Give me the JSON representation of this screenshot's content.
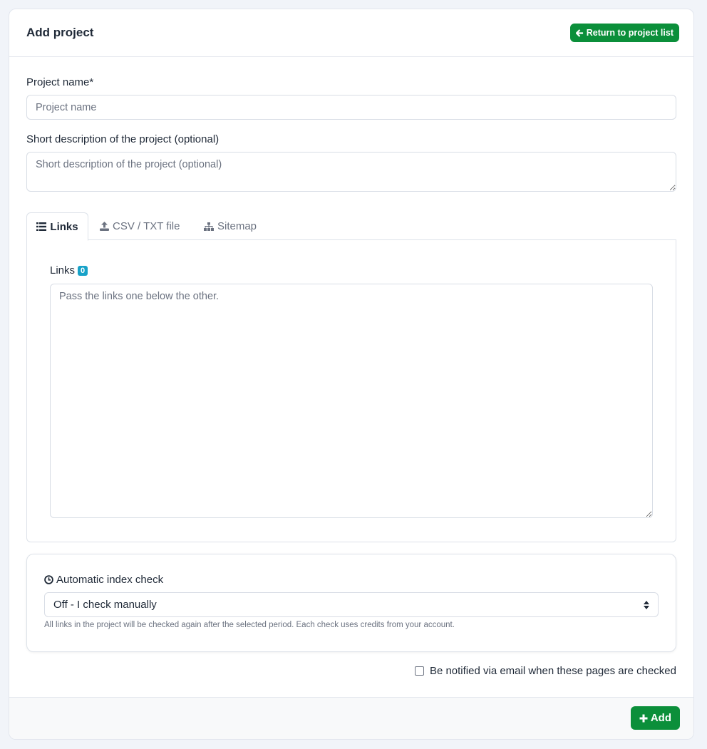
{
  "header": {
    "title": "Add project",
    "return_button": "Return to project list"
  },
  "form": {
    "project_name_label": "Project name*",
    "project_name_placeholder": "Project name",
    "description_label": "Short description of the project (optional)",
    "description_placeholder": "Short description of the project (optional)"
  },
  "tabs": [
    {
      "label": "Links",
      "icon": "list-icon",
      "active": true
    },
    {
      "label": "CSV / TXT file",
      "icon": "upload-icon",
      "active": false
    },
    {
      "label": "Sitemap",
      "icon": "sitemap-icon",
      "active": false
    }
  ],
  "links_pane": {
    "label": "Links",
    "count": "0",
    "placeholder": "Pass the links one below the other."
  },
  "index_check": {
    "label": "Automatic index check",
    "selected": "Off - I check manually",
    "hint": "All links in the project will be checked again after the selected period. Each check uses credits from your account."
  },
  "notify": {
    "label": "Be notified via email when these pages are checked",
    "checked": false
  },
  "footer": {
    "add_button": "Add"
  },
  "colors": {
    "primary_green": "#0b8f3a",
    "badge_blue": "#17a2c8"
  }
}
